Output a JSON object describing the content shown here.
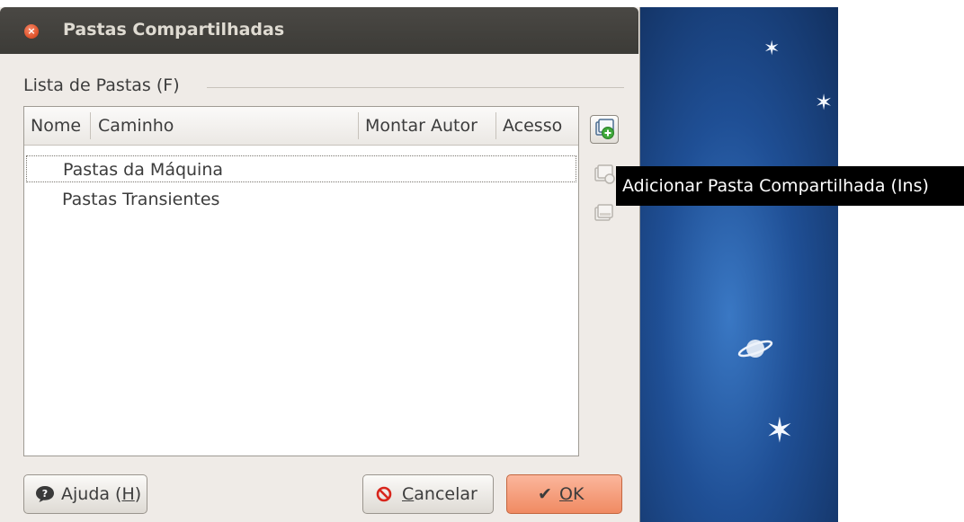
{
  "dialog": {
    "title": "Pastas Compartilhadas",
    "close_glyph": "×",
    "group_label": "Lista de Pastas (F)"
  },
  "list": {
    "columns": [
      "Nome",
      "Caminho",
      "Montar Autor",
      "Acesso"
    ],
    "rows": [
      {
        "label": "Pastas da Máquina",
        "selected": true
      },
      {
        "label": "Pastas Transientes",
        "selected": false
      }
    ]
  },
  "side_buttons": {
    "add_icon": "add-folder-icon",
    "edit_icon": "edit-folder-icon",
    "remove_icon": "remove-folder-icon"
  },
  "tooltip": "Adicionar Pasta Compartilhada (Ins)",
  "buttons": {
    "help_prefix": "Ajuda (",
    "help_key": "H",
    "help_suffix": ")",
    "cancel_key": "C",
    "cancel_rest": "ancelar",
    "ok_key": "O",
    "ok_rest": "K"
  },
  "colors": {
    "titlebar": "#3c3b37",
    "dialog_bg": "#efebe7",
    "ok_accent": "#f08a62",
    "close_accent": "#e2572f"
  }
}
